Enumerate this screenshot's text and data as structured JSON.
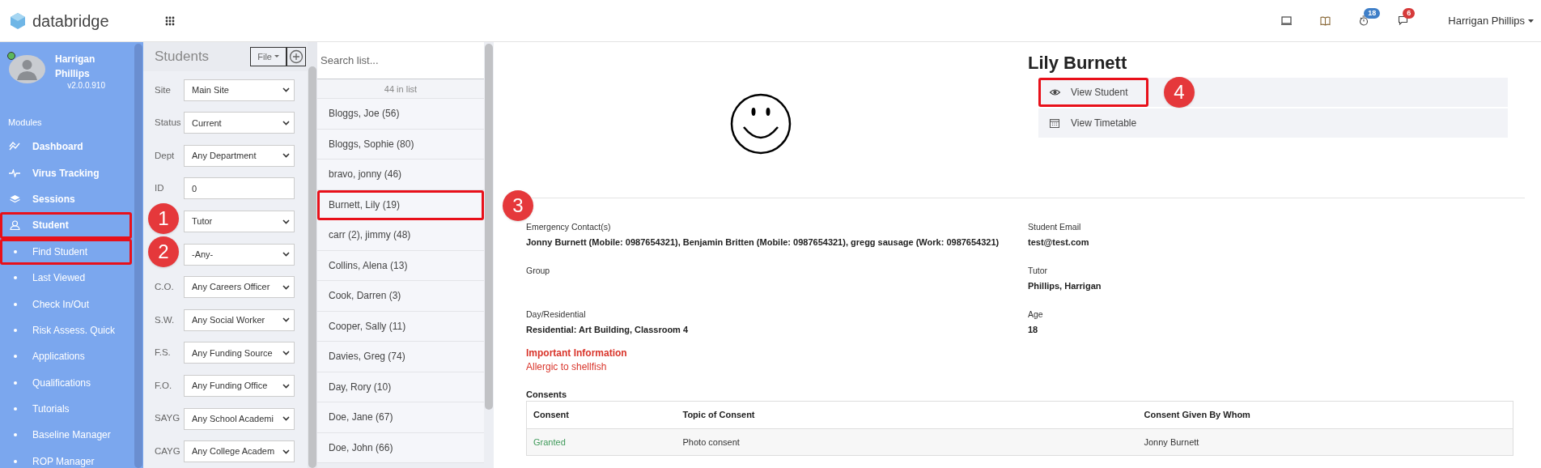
{
  "header": {
    "brand": "databridge",
    "icons": [
      {
        "kind": "monitor"
      },
      {
        "kind": "book"
      },
      {
        "kind": "timer",
        "badge": "18",
        "color": "#3f7fc8"
      },
      {
        "kind": "chat",
        "badge": "6",
        "color": "#d63a3a"
      }
    ],
    "user": "Harrigan Phillips"
  },
  "sidebar": {
    "user_name": "Harrigan Phillips",
    "version": "v2.0.0.910",
    "online": true,
    "section": "Modules",
    "items": [
      {
        "kind": "module",
        "label": "Dashboard",
        "highlighted": false
      },
      {
        "kind": "module",
        "label": "Virus Tracking",
        "highlighted": false
      },
      {
        "kind": "module",
        "label": "Sessions",
        "highlighted": false
      },
      {
        "kind": "module",
        "label": "Student",
        "highlighted": true
      },
      {
        "kind": "subitem",
        "label": "Find Student",
        "highlighted": true
      },
      {
        "kind": "subitem",
        "label": "Last Viewed",
        "highlighted": false
      },
      {
        "kind": "subitem",
        "label": "Check In/Out",
        "highlighted": false
      },
      {
        "kind": "subitem",
        "label": "Risk Assess. Quick",
        "highlighted": false
      },
      {
        "kind": "subitem",
        "label": "Applications",
        "highlighted": false
      },
      {
        "kind": "subitem",
        "label": "Qualifications",
        "highlighted": false
      },
      {
        "kind": "subitem",
        "label": "Tutorials",
        "highlighted": false
      },
      {
        "kind": "subitem",
        "label": "Baseline Manager",
        "highlighted": false
      },
      {
        "kind": "subitem",
        "label": "ROP Manager",
        "highlighted": false
      }
    ]
  },
  "filters": {
    "title": "Students",
    "file_button": "File",
    "rows": [
      {
        "kind": "select",
        "label": "Site",
        "value": "Main Site"
      },
      {
        "kind": "select",
        "label": "Status",
        "value": "Current"
      },
      {
        "kind": "select",
        "label": "Dept",
        "value": "Any Department"
      },
      {
        "kind": "input",
        "label": "ID",
        "value": "0"
      },
      {
        "kind": "select",
        "callout": "1",
        "value": "Tutor"
      },
      {
        "kind": "select",
        "callout": "2",
        "value": "-Any-"
      },
      {
        "kind": "select",
        "label": "C.O.",
        "value": "Any Careers Officer"
      },
      {
        "kind": "select",
        "label": "S.W.",
        "value": "Any Social Worker"
      },
      {
        "kind": "select",
        "label": "F.S.",
        "value": "Any Funding Source"
      },
      {
        "kind": "select",
        "label": "F.O.",
        "value": "Any Funding Office"
      },
      {
        "kind": "select",
        "label": "SAYG",
        "value": "Any School Academi"
      },
      {
        "kind": "select",
        "label": "CAYG",
        "value": "Any College Academ"
      }
    ]
  },
  "list": {
    "placeholder": "Search list...",
    "count": "44 in list",
    "items": [
      {
        "name": "Bloggs, Joe (56)",
        "highlighted": false
      },
      {
        "name": "Bloggs, Sophie (80)",
        "highlighted": false
      },
      {
        "name": "bravo, jonny (46)",
        "highlighted": false
      },
      {
        "name": "Burnett, Lily (19)",
        "highlighted": true
      },
      {
        "name": "carr (2), jimmy (48)",
        "highlighted": false
      },
      {
        "name": "Collins, Alena (13)",
        "highlighted": false
      },
      {
        "name": "Cook, Darren (3)",
        "highlighted": false
      },
      {
        "name": "Cooper, Sally (11)",
        "highlighted": false
      },
      {
        "name": "Davies, Greg (74)",
        "highlighted": false
      },
      {
        "name": "Day, Rory (10)",
        "highlighted": false
      },
      {
        "name": "Doe, Jane (67)",
        "highlighted": false
      },
      {
        "name": "Doe, John (66)",
        "highlighted": false
      }
    ]
  },
  "profile": {
    "name": "Lily Burnett",
    "actions": [
      {
        "kind": "view",
        "label": "View Student",
        "highlighted": true,
        "callout": "4"
      },
      {
        "kind": "timetable",
        "label": "View Timetable",
        "highlighted": false
      }
    ]
  },
  "details": {
    "callout": "3",
    "fields": [
      {
        "label": "Emergency Contact(s)",
        "value": "Jonny Burnett (Mobile: 0987654321), Benjamin Britten (Mobile: 0987654321), gregg sausage (Work: 0987654321)"
      },
      {
        "label": "Student Email",
        "value": "test@test.com"
      },
      {
        "label": "Group"
      },
      {
        "label": "Tutor",
        "value": "Phillips, Harrigan"
      },
      {
        "label": "Day/Residential",
        "value": "Residential: Art Building, Classroom 4"
      },
      {
        "label": "Age",
        "value": "18"
      }
    ],
    "important": {
      "title": "Important Information",
      "text": "Allergic to shellfish"
    },
    "consents": {
      "title": "Consents",
      "columns": [
        "Consent",
        "Topic of Consent",
        "Consent Given By Whom"
      ],
      "rows": [
        {
          "color": "#3f9a5a",
          "cells": [
            "Granted",
            "Photo consent",
            "Jonny Burnett"
          ]
        }
      ]
    }
  }
}
